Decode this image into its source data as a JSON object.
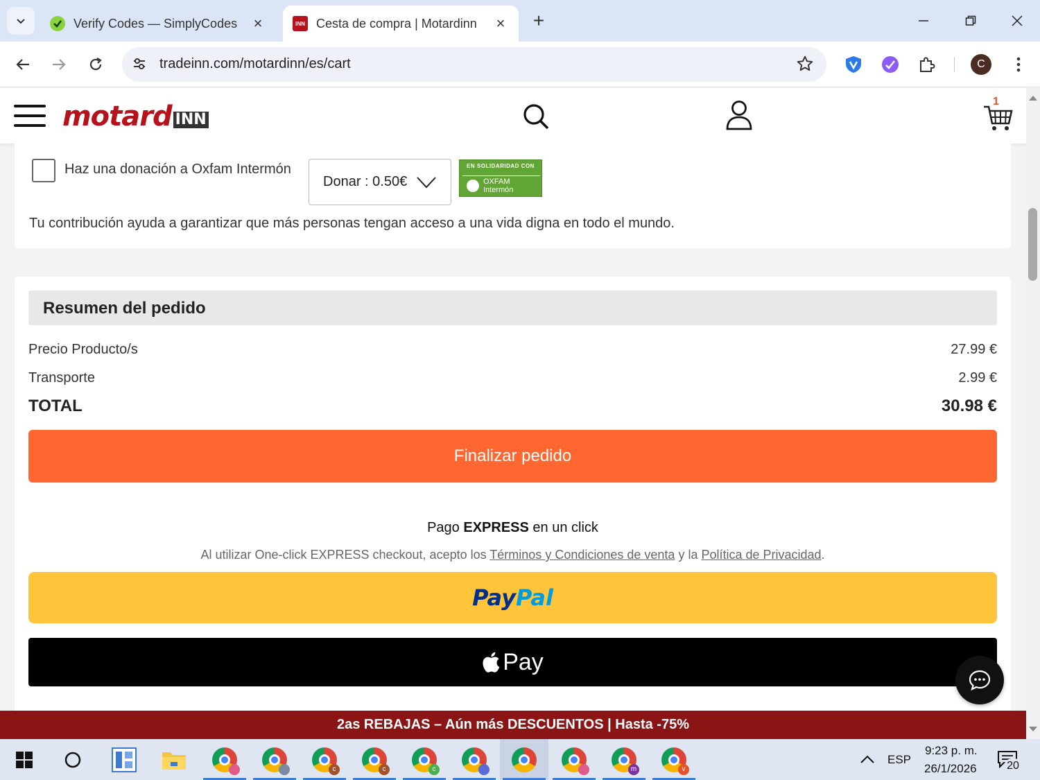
{
  "browser": {
    "tabs": [
      {
        "title": "Verify Codes — SimplyCodes",
        "active": false
      },
      {
        "title": "Cesta de compra | Motardinn",
        "active": true
      }
    ],
    "url": "tradeinn.com/motardinn/es/cart",
    "profile_initial": "C"
  },
  "site": {
    "logo_main": "motard",
    "logo_box": "INN",
    "cart_count": "1"
  },
  "donation": {
    "label": "Haz una donación a Oxfam Intermón",
    "select_value": "Donar : 0.50€",
    "badge_top": "EN SOLIDARIDAD CON",
    "badge_bottom": "OXFAM Intermón",
    "description": "Tu contribución ayuda a garantizar que más personas tengan acceso a una vida digna en todo el mundo."
  },
  "summary": {
    "title": "Resumen del pedido",
    "rows": [
      {
        "label": "Precio Producto/s",
        "value": "27.99 €"
      },
      {
        "label": "Transporte",
        "value": "2.99 €"
      }
    ],
    "total_label": "TOTAL",
    "total_value": "30.98 €",
    "finish_label": "Finalizar pedido",
    "express_prefix": "Pago ",
    "express_bold": "EXPRESS",
    "express_suffix": " en un click",
    "legal_prefix": "Al utilizar One-click EXPRESS checkout, acepto los ",
    "legal_link1": "Términos y Condiciones de venta",
    "legal_mid": " y la ",
    "legal_link2": "Política de Privacidad",
    "legal_end": ".",
    "paypal_part1": "Pay",
    "paypal_part2": "Pal",
    "applepay_label": "Pay"
  },
  "promo": "2as REBAJAS – Aún más DESCUENTOS | Hasta -75%",
  "taskbar": {
    "chrome_badges": [
      "",
      "",
      "c",
      "c",
      "c",
      "",
      "",
      "",
      "m",
      "v"
    ],
    "lang": "ESP",
    "time": "9:23 p. m.",
    "date": "26/1/2026",
    "notifications": "20"
  },
  "colors": {
    "accent_orange": "#ff6630",
    "brand_red": "#b5121b",
    "paypal_yellow": "#ffc43a",
    "promo_red": "#8b1515"
  }
}
